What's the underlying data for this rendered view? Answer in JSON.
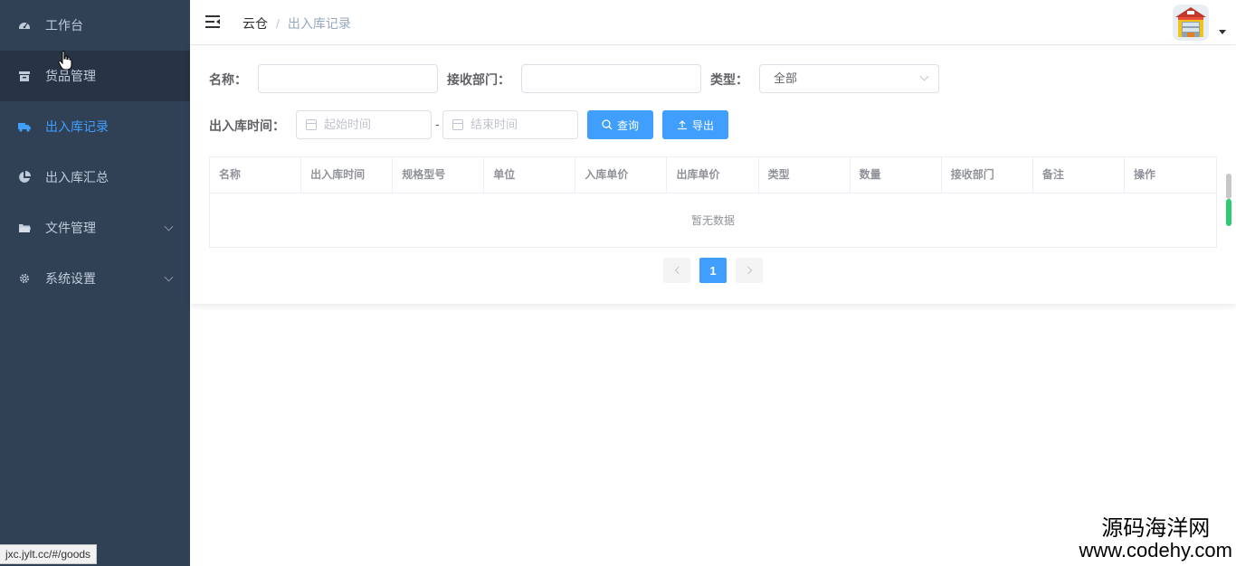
{
  "sidebar": {
    "items": [
      {
        "label": "工作台",
        "icon": "dashboard-icon"
      },
      {
        "label": "货品管理",
        "icon": "archive-icon"
      },
      {
        "label": "出入库记录",
        "icon": "truck-icon"
      },
      {
        "label": "出入库汇总",
        "icon": "pie-chart-icon"
      },
      {
        "label": "文件管理",
        "icon": "folder-icon"
      },
      {
        "label": "系统设置",
        "icon": "gear-icon"
      }
    ],
    "active_color": "#409eff",
    "bg_color": "#304156"
  },
  "navbar": {
    "breadcrumb_home": "云仓",
    "breadcrumb_sep": "/",
    "breadcrumb_current": "出入库记录"
  },
  "filters": {
    "name_label": "名称：",
    "name_value": "",
    "dept_label": "接收部门：",
    "dept_value": "",
    "type_label": "类型：",
    "type_value": "全部",
    "time_label": "出入库时间：",
    "start_placeholder": "起始时间",
    "end_placeholder": "结束时间",
    "range_sep": "-",
    "search_button": "查询",
    "export_button": "导出"
  },
  "table": {
    "headers": [
      "名称",
      "出入库时间",
      "规格型号",
      "单位",
      "入库单价",
      "出库单价",
      "类型",
      "数量",
      "接收部门",
      "备注",
      "操作"
    ],
    "empty_text": "暂无数据"
  },
  "pagination": {
    "current_page": "1"
  },
  "statusbar": {
    "url": "jxc.jylt.cc/#/goods"
  },
  "watermark": {
    "line1": "源码海洋网",
    "line2": "www.codehy.com"
  }
}
